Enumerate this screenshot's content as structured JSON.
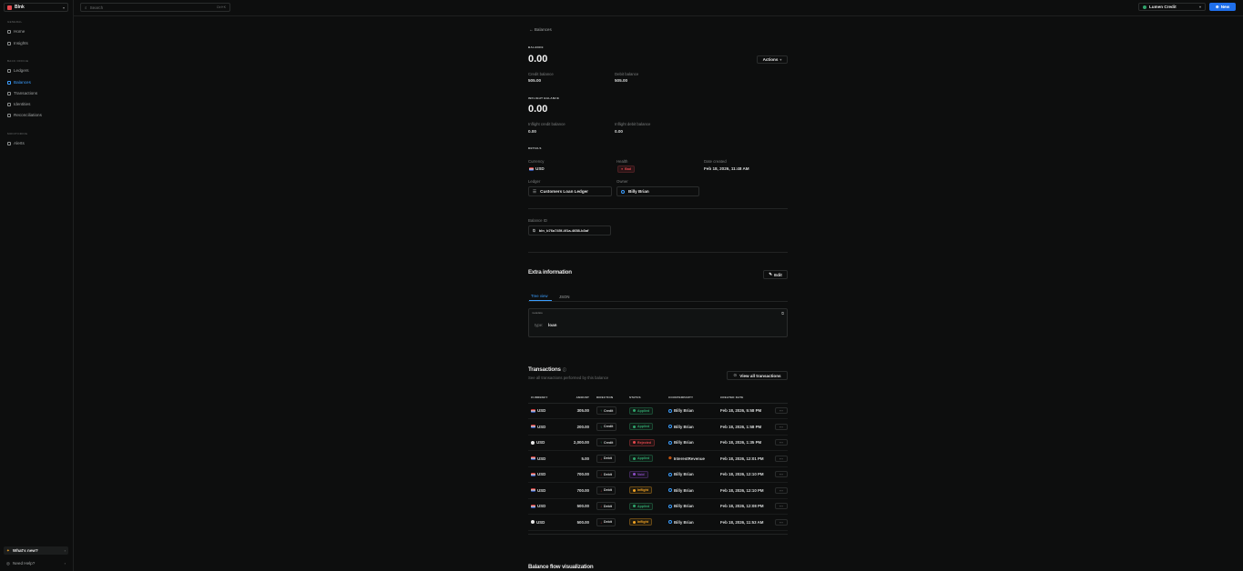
{
  "org": {
    "name": "Blnk"
  },
  "search": {
    "placeholder": "Search",
    "shortcut": "Ctrl+K"
  },
  "env": {
    "label": "Lumen Credit"
  },
  "new_button": "New",
  "nav": {
    "general_label": "GENERAL",
    "backoffice_label": "BACK OFFICE",
    "monitoring_label": "MONITORING",
    "items": [
      "Home",
      "Insights",
      "Ledgers",
      "Balances",
      "Transactions",
      "Identities",
      "Reconciliations",
      "Alerts"
    ]
  },
  "footer": {
    "whats_new": "What's new?",
    "need_help": "Need Help?"
  },
  "breadcrumb": "← Balances",
  "balance": {
    "title": "BALANCE",
    "amount": "0.00",
    "actions_label": "Actions",
    "credit_label": "Credit balance",
    "credit_value": "505.00",
    "debit_label": "Debit balance",
    "debit_value": "505.00"
  },
  "inflight": {
    "title": "INFLIGHT BALANCE",
    "amount": "0.00",
    "credit_label": "Inflight credit balance",
    "credit_value": "0.00",
    "debit_label": "Inflight debit balance",
    "debit_value": "0.00"
  },
  "details": {
    "title": "DETAILS",
    "currency_label": "Currency",
    "currency_value": "USD",
    "health_label": "Health",
    "health_value": "Bad",
    "date_label": "Date created",
    "date_value": "Feb 18, 2026, 11:48 AM",
    "ledger_label": "Ledger",
    "ledger_value": "Customers Loan Ledger",
    "owner_label": "Owner",
    "owner_value": "Billy Brian",
    "balance_id_label": "Balance ID",
    "balance_id_value": "bln_b76a745f-4f1a-4658-b3af"
  },
  "extra": {
    "title": "Extra information",
    "edit_label": "Edit",
    "tabs": [
      "Tree view",
      "JSON"
    ],
    "root_label": "metadata",
    "key": "type:",
    "value": "loan"
  },
  "transactions": {
    "title": "Transactions",
    "subtitle": "See all transactions performed by this balance",
    "view_all": "View all transactions",
    "columns": [
      "CURRENCY",
      "AMOUNT",
      "DIRECTION",
      "STATUS",
      "COUNTERPARTY",
      "CREATED DATE"
    ],
    "rows": [
      {
        "currency": "USD",
        "amount": "305.00",
        "direction": "Credit",
        "status": "Applied",
        "counterparty": "Billy Brian",
        "date": "Feb 18, 2026, 5:58 PM"
      },
      {
        "currency": "USD",
        "amount": "200.00",
        "direction": "Credit",
        "status": "Applied",
        "counterparty": "Billy Brian",
        "date": "Feb 18, 2026, 1:58 PM"
      },
      {
        "currency": "USD",
        "amount": "2,000.00",
        "direction": "Credit",
        "status": "Rejected",
        "counterparty": "Billy Brian",
        "date": "Feb 18, 2026, 1:35 PM"
      },
      {
        "currency": "USD",
        "amount": "5.00",
        "direction": "Debit",
        "status": "Applied",
        "counterparty": "InterestRevenue",
        "date": "Feb 18, 2026, 12:01 PM"
      },
      {
        "currency": "USD",
        "amount": "700.00",
        "direction": "Debit",
        "status": "Void",
        "counterparty": "Billy Brian",
        "date": "Feb 18, 2026, 12:10 PM"
      },
      {
        "currency": "USD",
        "amount": "700.00",
        "direction": "Debit",
        "status": "Inflight",
        "counterparty": "Billy Brian",
        "date": "Feb 18, 2026, 12:10 PM"
      },
      {
        "currency": "USD",
        "amount": "500.00",
        "direction": "Debit",
        "status": "Applied",
        "counterparty": "Billy Brian",
        "date": "Feb 18, 2026, 12:08 PM"
      },
      {
        "currency": "USD",
        "amount": "500.00",
        "direction": "Debit",
        "status": "Inflight",
        "counterparty": "Billy Brian",
        "date": "Feb 18, 2026, 11:53 AM"
      }
    ]
  },
  "flow": {
    "title": "Balance flow visualization"
  },
  "colors": {
    "accent": "#3b9eff",
    "applied": "#30a46c",
    "rejected": "#e5484d",
    "void": "#8e4ec6",
    "inflight": "#f5a524"
  }
}
